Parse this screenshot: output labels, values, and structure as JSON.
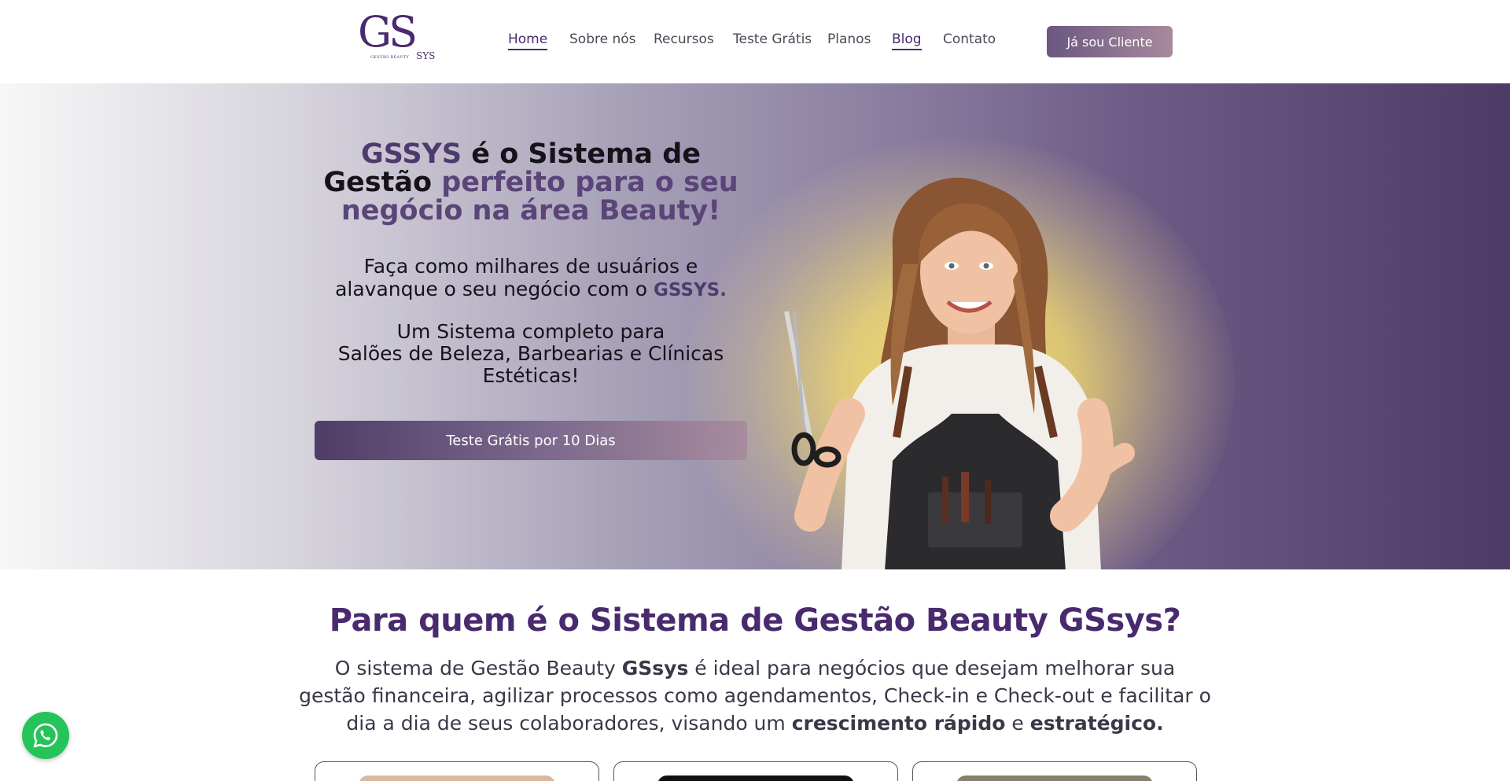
{
  "header": {
    "logo": {
      "main": "GS",
      "suffix": "SYS",
      "tagline": "GESTÃO BEAUTY"
    },
    "nav": [
      {
        "label": "Home",
        "active": true
      },
      {
        "label": "Sobre nós",
        "active": false
      },
      {
        "label": "Recursos",
        "active": false
      },
      {
        "label": "Teste Grátis",
        "active": false
      },
      {
        "label": "Planos",
        "active": false
      },
      {
        "label": "Blog",
        "active": true
      },
      {
        "label": "Contato",
        "active": false
      }
    ],
    "client_button": "Já sou Cliente"
  },
  "hero": {
    "title": {
      "brand": "GSSYS",
      "part1": " é o Sistema de Gestão ",
      "highlight": "perfeito para o seu negócio na área Beauty!"
    },
    "paragraph1": {
      "text": "Faça como milhares de usuários e alavanque o seu negócio com o ",
      "brand": "GSSYS."
    },
    "paragraph2": {
      "line1": "Um Sistema completo para",
      "line2": "Salões de Beleza, Barbearias e Clínicas Estéticas!"
    },
    "cta": "Teste Grátis por 10 Dias"
  },
  "section2": {
    "title": "Para quem é o Sistema de Gestão Beauty GSsys?",
    "text": {
      "part1": "O sistema de Gestão Beauty ",
      "brand": "GSsys",
      "part2": " é ideal para negócios que desejam melhorar sua gestão financeira, agilizar processos como agendamentos, Check-in e Check-out e facilitar o dia a dia de seus colaboradores, visando um ",
      "bold1": "crescimento rápido",
      "part3": " e ",
      "bold2": "estratégico."
    }
  },
  "colors": {
    "brand_purple": "#4a2a6e",
    "whatsapp_green": "#25c45a",
    "hero_glow": "#fce660"
  },
  "icons": {
    "whatsapp": "whatsapp-icon"
  }
}
